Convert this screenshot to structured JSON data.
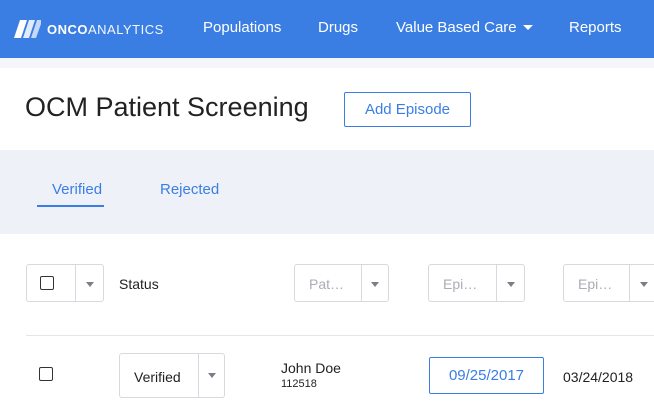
{
  "nav": {
    "logo_bold": "ONCO",
    "logo_light": "ANALYTICS",
    "items": [
      "Populations",
      "Drugs",
      "Value Based Care",
      "Reports"
    ],
    "brand_color": "#3a7ee4"
  },
  "page": {
    "title": "OCM Patient Screening",
    "add_button": "Add Episode"
  },
  "tabs": [
    {
      "label": "Verified",
      "active": true
    },
    {
      "label": "Rejected",
      "active": false
    }
  ],
  "table": {
    "status_header": "Status",
    "filters": [
      "Pat…",
      "Epi…",
      "Epi…"
    ],
    "rows": [
      {
        "checked": false,
        "status": "Verified",
        "patient_name": "John Doe",
        "patient_id": "112518",
        "episode_start": "09/25/2017",
        "episode_end": "03/24/2018"
      }
    ]
  }
}
